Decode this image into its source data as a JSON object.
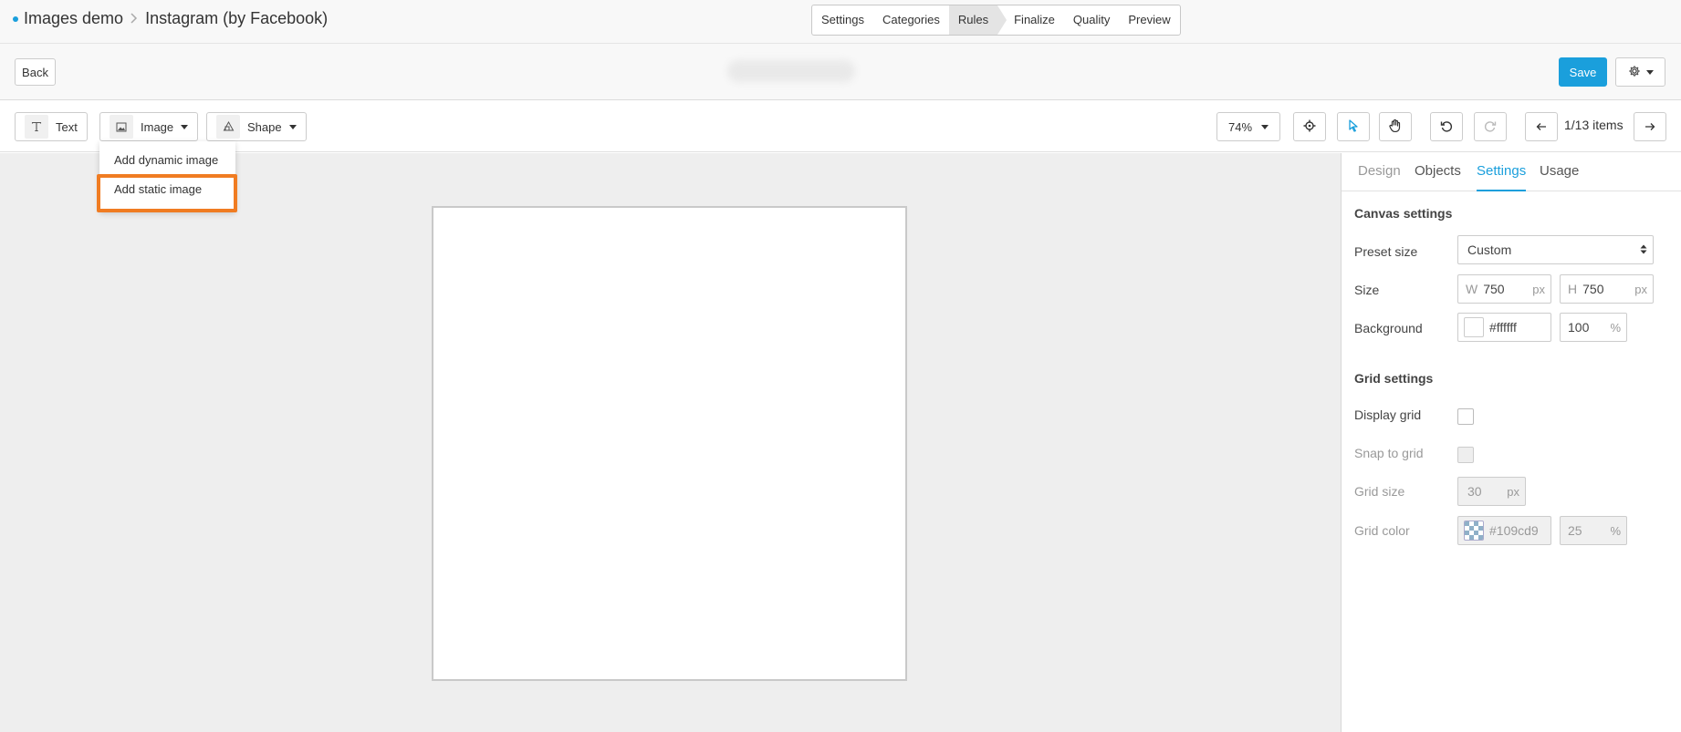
{
  "breadcrumb": {
    "project": "Images demo",
    "channel": "Instagram (by Facebook)"
  },
  "steps": [
    "Settings",
    "Categories",
    "Rules",
    "Finalize",
    "Quality",
    "Preview"
  ],
  "active_step": "Rules",
  "actionbar": {
    "back_label": "Back",
    "save_label": "Save"
  },
  "toolbar": {
    "text_label": "Text",
    "image_label": "Image",
    "shape_label": "Shape",
    "zoom": "74%",
    "items": "1/13 items"
  },
  "image_menu": {
    "dynamic": "Add dynamic image",
    "static": "Add static image"
  },
  "panel": {
    "tabs": [
      "Design",
      "Objects",
      "Settings",
      "Usage"
    ],
    "active_tab": "Settings",
    "canvas_title": "Canvas settings",
    "preset_label": "Preset size",
    "preset_value": "Custom",
    "size_label": "Size",
    "w_prefix": "W",
    "h_prefix": "H",
    "width": "750",
    "height": "750",
    "unit_px": "px",
    "background_label": "Background",
    "background_color": "#ffffff",
    "background_opacity": "100",
    "percent": "%",
    "grid_title": "Grid settings",
    "display_grid_label": "Display grid",
    "snap_label": "Snap to grid",
    "grid_size_label": "Grid size",
    "grid_size": "30",
    "grid_color_label": "Grid color",
    "grid_color": "#109cd9",
    "grid_opacity": "25"
  },
  "colors": {
    "accent": "#1a9fdc",
    "highlight": "#f07c22"
  }
}
